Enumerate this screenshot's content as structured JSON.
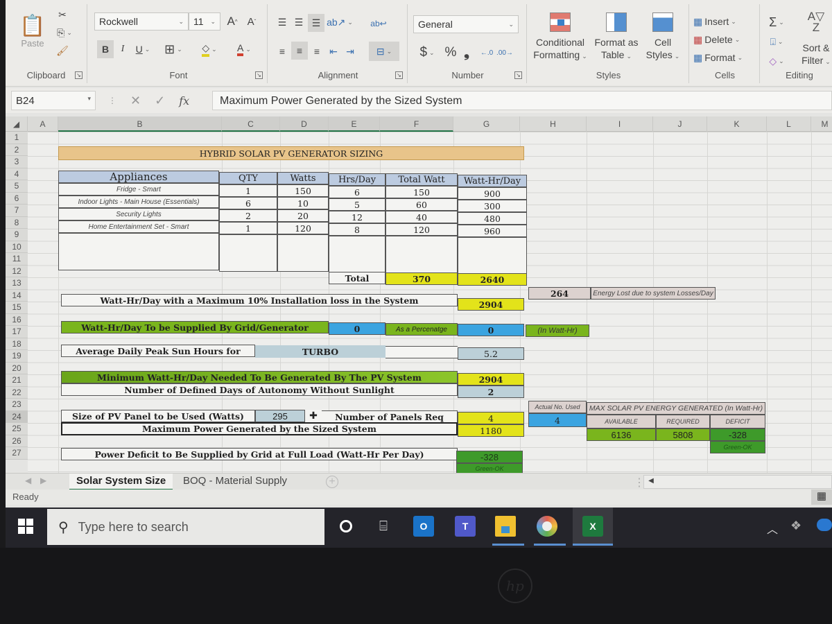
{
  "ribbon": {
    "clipboard": {
      "paste": "Paste",
      "label": "Clipboard"
    },
    "font": {
      "name": "Rockwell",
      "size": "11",
      "bold": "B",
      "italic": "I",
      "underline": "U",
      "label": "Font"
    },
    "alignment": {
      "label": "Alignment"
    },
    "number": {
      "format": "General",
      "currency": "$",
      "percent": "%",
      "comma": "❟",
      "label": "Number"
    },
    "styles": {
      "conditional": [
        "Conditional",
        "Formatting"
      ],
      "format_table": [
        "Format as",
        "Table"
      ],
      "cell_styles": [
        "Cell",
        "Styles"
      ],
      "label": "Styles"
    },
    "cells": {
      "insert": "Insert",
      "delete": "Delete",
      "format": "Format",
      "label": "Cells"
    },
    "editing": {
      "sort": [
        "Sort &",
        "Filter"
      ],
      "label": "Editing"
    }
  },
  "formula_bar": {
    "name_box": "B24",
    "fx": "fx",
    "content": "Maximum Power Generated by the Sized System"
  },
  "columns": [
    "A",
    "B",
    "C",
    "D",
    "E",
    "F",
    "G",
    "H",
    "I",
    "J",
    "K",
    "L",
    "M"
  ],
  "rows": [
    "1",
    "2",
    "3",
    "4",
    "5",
    "6",
    "7",
    "8",
    "9",
    "10",
    "11",
    "12",
    "13",
    "14",
    "15",
    "16",
    "17",
    "18",
    "19",
    "20",
    "21",
    "22",
    "23",
    "24",
    "25",
    "26",
    "27"
  ],
  "sheet": {
    "title": "HYBRID SOLAR PV GENERATOR SIZING",
    "table_headers": [
      "Appliances",
      "QTY",
      "Watts",
      "Hrs/Day",
      "Total Watt",
      "Watt-Hr/Day"
    ],
    "appliances": [
      {
        "name": "Fridge - Smart",
        "qty": "1",
        "watts": "150",
        "hrs": "6",
        "total": "150",
        "wh": "900"
      },
      {
        "name": "Indoor Lights - Main House (Essentials)",
        "qty": "6",
        "watts": "10",
        "hrs": "5",
        "total": "60",
        "wh": "300"
      },
      {
        "name": "Security Lights",
        "qty": "2",
        "watts": "20",
        "hrs": "12",
        "total": "40",
        "wh": "480"
      },
      {
        "name": "Home Entertainment Set - Smart",
        "qty": "1",
        "watts": "120",
        "hrs": "8",
        "total": "120",
        "wh": "960"
      }
    ],
    "total_label": "Total",
    "total_watt": "370",
    "total_wh": "2640",
    "loss_value": "264",
    "loss_label": "Energy Lost due to system Losses/Day",
    "install_loss_label": "Watt-Hr/Day  with a Maximum 10% Installation loss in the System",
    "install_loss_value": "2904",
    "grid_label": "Watt-Hr/Day To be Supplied By Grid/Generator",
    "grid_value": "0",
    "pct_label": "As a Percenatge",
    "pct_value": "0",
    "in_wh": "(In Watt-Hr)",
    "sun_label": "Average Daily Peak Sun Hours for",
    "sun_location": "TURBO",
    "sun_value": "5.2",
    "min_wh_label": "Minimum Watt-Hr/Day Needed To Be Generated By The PV System",
    "min_wh_value": "2904",
    "autonomy_label": "Number of Defined Days of Autonomy Without Sunlight",
    "autonomy_value": "2",
    "panel_size_label": "Size of PV Panel to be Used (Watts)",
    "panel_size_value": "295",
    "panels_req_label": "Number of Panels Req",
    "panels_req_value": "4",
    "max_power_label": "Maximum Power Generated by the Sized System",
    "max_power_value": "1180",
    "deficit_label": "Power Deficit to Be Supplied by Grid at Full Load (Watt-Hr Per Day)",
    "deficit_value": "-328",
    "deficit_status": "Green-OK",
    "actual_used_label": "Actual No. Used",
    "actual_used_value": "4",
    "max_energy_title": "MAX SOLAR PV ENERGY GENERATED (In Watt-Hr)",
    "energy_headers": [
      "AVAILABLE",
      "REQUIRED",
      "DEFICIT"
    ],
    "energy_values": [
      "6136",
      "5808",
      "-328"
    ],
    "energy_status": "Green-OK"
  },
  "tabs": [
    {
      "label": "Solar System Size",
      "active": true
    },
    {
      "label": "BOQ - Material Supply",
      "active": false
    }
  ],
  "status": {
    "text": "Ready"
  },
  "taskbar": {
    "search_placeholder": "Type here to search"
  }
}
